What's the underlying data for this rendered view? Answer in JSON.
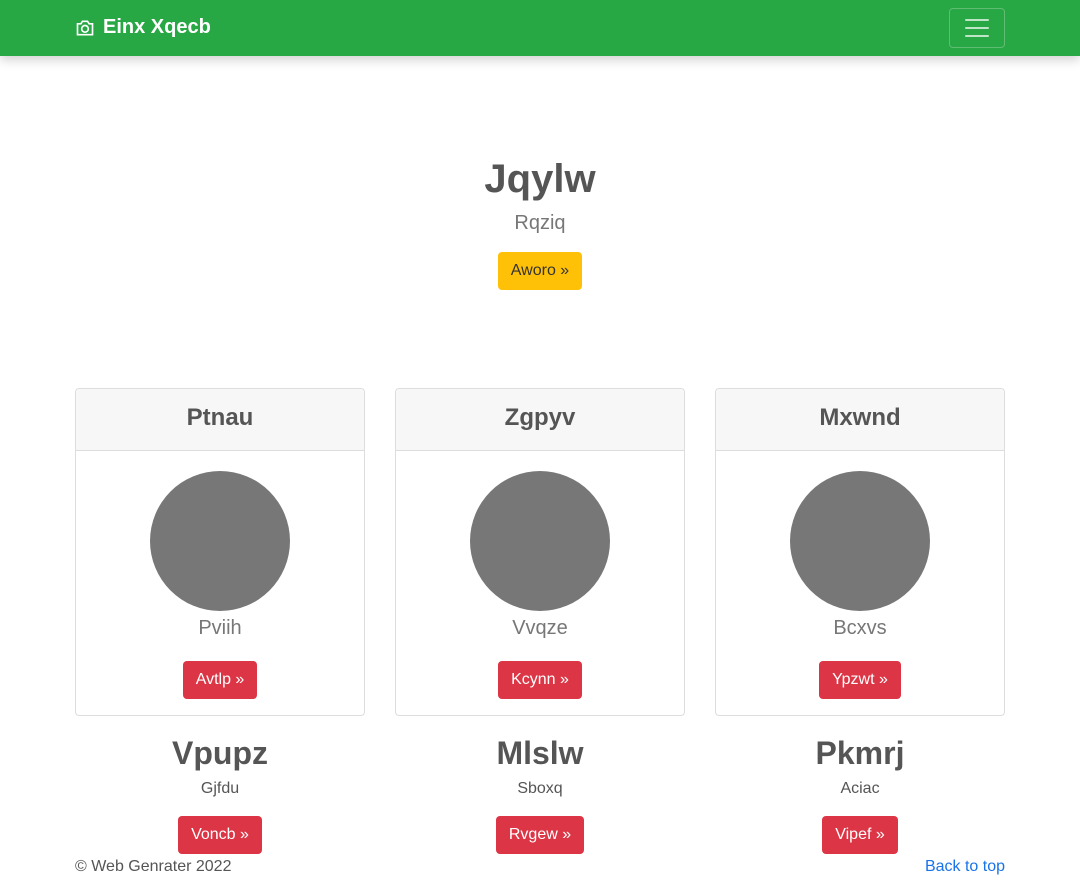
{
  "navbar": {
    "brand": "Einx Xqecb",
    "brand_icon": "camera-icon",
    "toggler_icon": "hamburger-icon"
  },
  "hero": {
    "title": "Jqylw",
    "subtitle": "Rqziq",
    "button": "Aworo »"
  },
  "cards": [
    {
      "header": "Ptnau",
      "text": "Pviih",
      "button": "Avtlp »"
    },
    {
      "header": "Zgpyv",
      "text": "Vvqze",
      "button": "Kcynn »"
    },
    {
      "header": "Mxwnd",
      "text": "Bcxvs",
      "button": "Ypzwt »"
    }
  ],
  "columns": [
    {
      "title": "Vpupz",
      "text": "Gjfdu",
      "button": "Voncb »"
    },
    {
      "title": "Mlslw",
      "text": "Sboxq",
      "button": "Rvgew »"
    },
    {
      "title": "Pkmrj",
      "text": "Aciac",
      "button": "Vipef »"
    }
  ],
  "footer": {
    "copyright": "© Web Genrater 2022",
    "back_to_top": "Back to top"
  },
  "colors": {
    "navbar": "#28a745",
    "warning": "#ffc107",
    "danger": "#dc3545",
    "avatar": "#777777",
    "link": "#1a73e8"
  }
}
